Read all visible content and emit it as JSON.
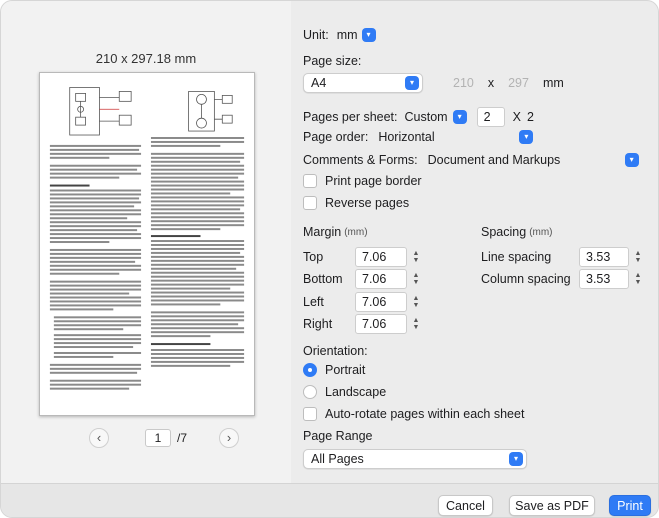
{
  "preview": {
    "paper_size": "210 x 297.18 mm",
    "prev_icon": "chevron-left-icon",
    "next_icon": "chevron-right-icon",
    "current_page": "1",
    "total_pages": "/7"
  },
  "settings": {
    "unit": {
      "label": "Unit:",
      "value": "mm"
    },
    "page_size": {
      "label": "Page size:",
      "value": "A4",
      "width": "210",
      "x": "x",
      "height": "297",
      "unit": "mm"
    },
    "pages_per_sheet": {
      "label": "Pages per sheet:",
      "value": "Custom",
      "cols": "2",
      "x": "X",
      "rows": "2"
    },
    "page_order": {
      "label": "Page order:",
      "value": "Horizontal"
    },
    "comments_forms": {
      "label": "Comments & Forms:",
      "value": "Document and Markups"
    },
    "print_page_border": {
      "label": "Print page border",
      "checked": false
    },
    "reverse_pages": {
      "label": "Reverse pages",
      "checked": false
    },
    "margin": {
      "label": "Margin",
      "unit": "(mm)",
      "top_label": "Top",
      "top": "7.06",
      "bottom_label": "Bottom",
      "bottom": "7.06",
      "left_label": "Left",
      "left": "7.06",
      "right_label": "Right",
      "right": "7.06"
    },
    "spacing": {
      "label": "Spacing",
      "unit": "(mm)",
      "line_label": "Line spacing",
      "line": "3.53",
      "column_label": "Column spacing",
      "column": "3.53"
    },
    "orientation": {
      "label": "Orientation:",
      "portrait": "Portrait",
      "landscape": "Landscape",
      "selected": "Portrait"
    },
    "auto_rotate": {
      "label": "Auto-rotate pages within each sheet",
      "checked": false
    },
    "page_range": {
      "label": "Page Range",
      "value": "All Pages"
    }
  },
  "footer": {
    "cancel": "Cancel",
    "save_pdf": "Save as PDF",
    "print": "Print"
  },
  "colors": {
    "accent": "#2f7bf5",
    "panel": "#ececec"
  }
}
